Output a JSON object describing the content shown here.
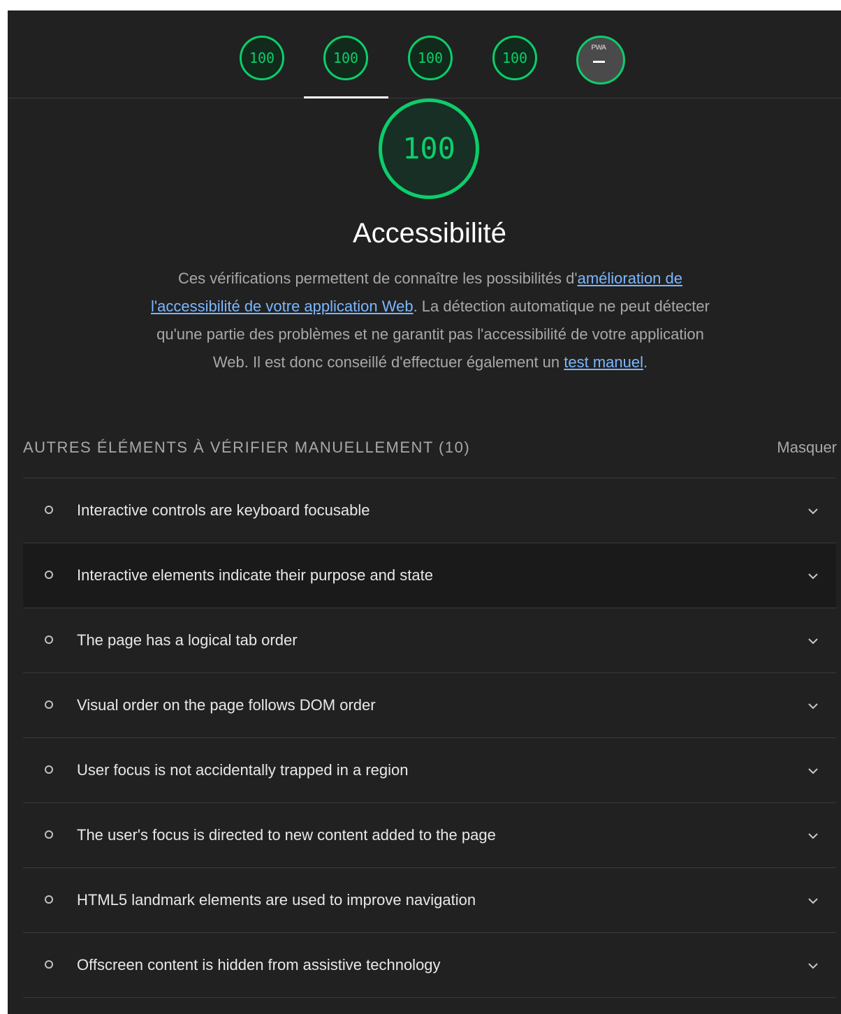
{
  "gauges": [
    {
      "score": "100"
    },
    {
      "score": "100"
    },
    {
      "score": "100"
    },
    {
      "score": "100"
    }
  ],
  "pwa": {
    "label": "PWA",
    "value": "–"
  },
  "category": {
    "score": "100",
    "title": "Accessibilité",
    "desc_part1": "Ces vérifications permettent de connaître les possibilités d'",
    "desc_link1": "amélioration de l'accessibilité de votre application Web",
    "desc_part2": ". La détection automatique ne peut détecter qu'une partie des problèmes et ne garantit pas l'accessibilité de votre application Web. Il est donc conseillé d'effectuer également un ",
    "desc_link2": "test manuel",
    "desc_part3": "."
  },
  "manual_group": {
    "title": "AUTRES ÉLÉMENTS À VÉRIFIER MANUELLEMENT (10)",
    "toggle_label": "Masquer"
  },
  "audits": [
    {
      "title": "Interactive controls are keyboard focusable"
    },
    {
      "title": "Interactive elements indicate their purpose and state"
    },
    {
      "title": "The page has a logical tab order"
    },
    {
      "title": "Visual order on the page follows DOM order"
    },
    {
      "title": "User focus is not accidentally trapped in a region"
    },
    {
      "title": "The user's focus is directed to new content added to the page"
    },
    {
      "title": "HTML5 landmark elements are used to improve navigation"
    },
    {
      "title": "Offscreen content is hidden from assistive technology"
    }
  ],
  "colors": {
    "pass_green": "#0cce6b",
    "background": "#212121",
    "link": "#7cb7ff"
  }
}
